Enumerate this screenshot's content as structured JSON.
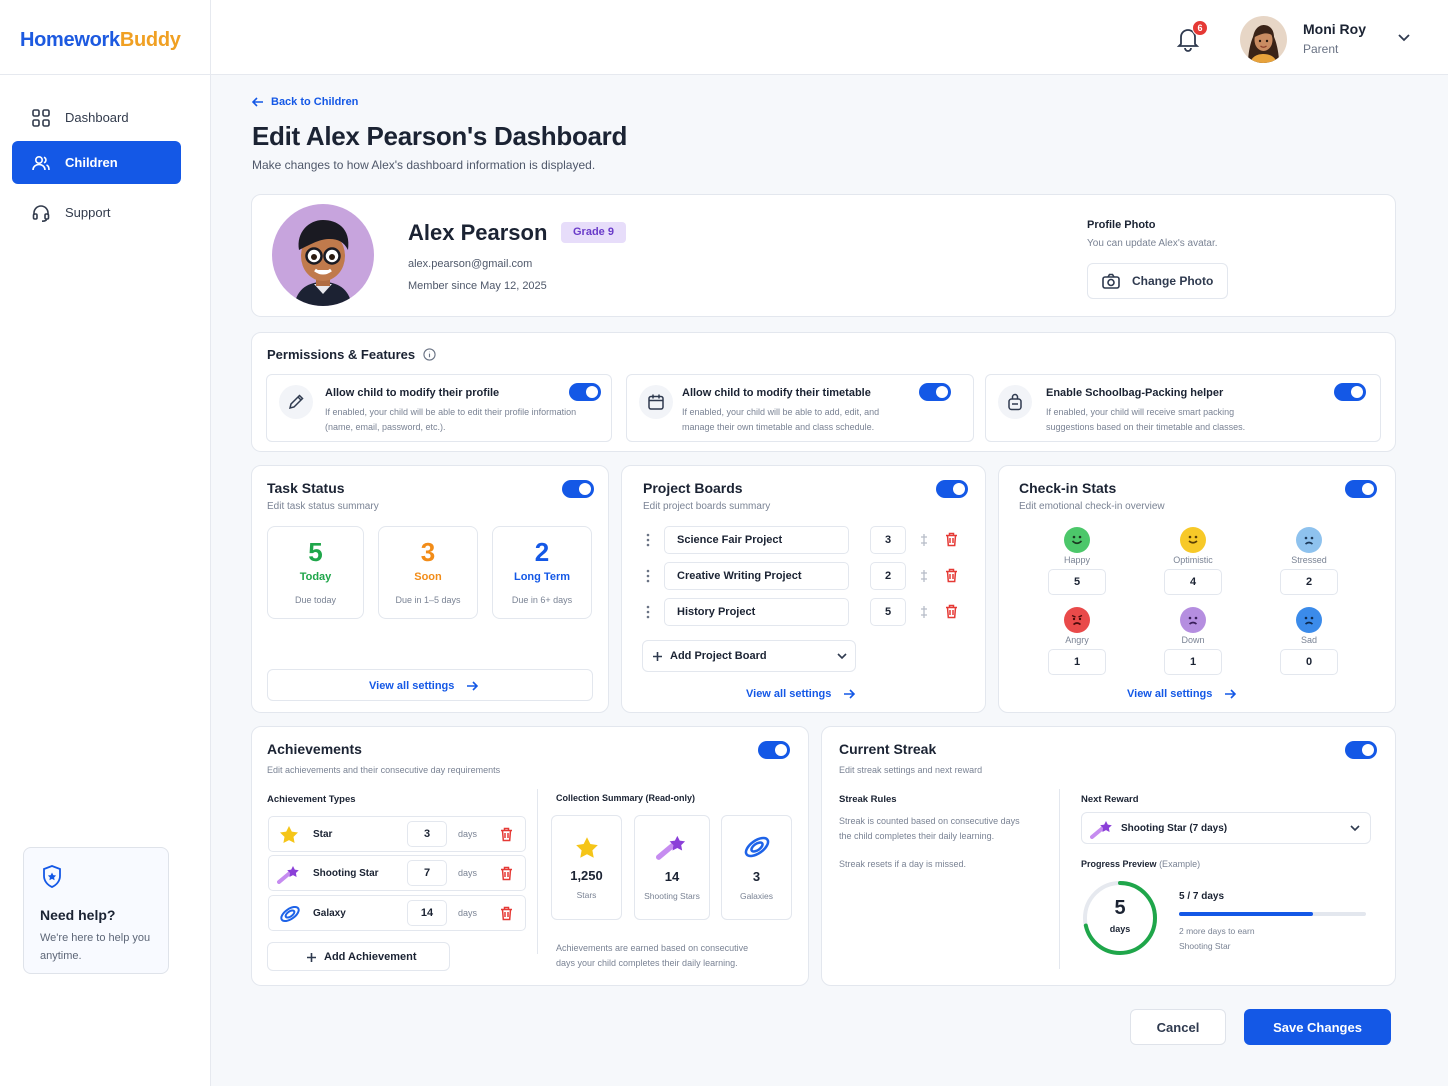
{
  "brand": {
    "part1": "Homework",
    "part2": "Buddy"
  },
  "sidebar": {
    "items": [
      {
        "label": "Dashboard",
        "icon": "grid-icon"
      },
      {
        "label": "Children",
        "icon": "users-icon",
        "active": true
      },
      {
        "label": "Support",
        "icon": "headset-icon"
      }
    ],
    "help": {
      "title": "Need help?",
      "text": "We're here to help you anytime."
    }
  },
  "topbar": {
    "notifications": "6",
    "user_name": "Moni Roy",
    "user_role": "Parent"
  },
  "page": {
    "back": "Back to Children",
    "title": "Edit Alex Pearson's Dashboard",
    "subtitle": "Make changes to how Alex's dashboard information is displayed."
  },
  "profile": {
    "name": "Alex Pearson",
    "grade": "Grade 9",
    "email": "alex.pearson@gmail.com",
    "member_since": "Member since May 12, 2025",
    "photo_title": "Profile Photo",
    "photo_sub": "You can update Alex's avatar.",
    "change_photo": "Change Photo"
  },
  "permissions": {
    "title": "Permissions & Features",
    "items": [
      {
        "title": "Allow child to modify their profile",
        "desc1": "If enabled, your child will be able to edit their profile information",
        "desc2": "(name, email, password, etc.).",
        "enabled": true
      },
      {
        "title": "Allow child to modify their timetable",
        "desc1": "If enabled, your child will be able to add, edit, and",
        "desc2": "manage their own timetable and class schedule.",
        "enabled": true
      },
      {
        "title": "Enable Schoolbag-Packing helper",
        "desc1": "If enabled, your child will receive smart packing",
        "desc2": "suggestions based on their timetable and classes.",
        "enabled": true
      }
    ]
  },
  "task_status": {
    "title": "Task Status",
    "subtitle": "Edit task status summary",
    "enabled": true,
    "stats": [
      {
        "value": "5",
        "label": "Today",
        "desc": "Due today",
        "color": "#1fa64a"
      },
      {
        "value": "3",
        "label": "Soon",
        "desc": "Due in 1–5 days",
        "color": "#f28c18"
      },
      {
        "value": "2",
        "label": "Long Term",
        "desc": "Due in 6+ days",
        "color": "#1458e6"
      }
    ],
    "link": "View all settings"
  },
  "project_boards": {
    "title": "Project Boards",
    "subtitle": "Edit project boards summary",
    "enabled": true,
    "items": [
      {
        "name": "Science Fair Project",
        "count": "3"
      },
      {
        "name": "Creative Writing Project",
        "count": "2"
      },
      {
        "name": "History Project",
        "count": "5"
      }
    ],
    "add": "Add Project Board",
    "link": "View all settings"
  },
  "checkin": {
    "title": "Check-in Stats",
    "subtitle": "Edit emotional check-in overview",
    "enabled": true,
    "moods": [
      {
        "label": "Happy",
        "value": "5",
        "color": "#4cc76a"
      },
      {
        "label": "Optimistic",
        "value": "4",
        "color": "#f7c928"
      },
      {
        "label": "Stressed",
        "value": "2",
        "color": "#8ec2ee"
      },
      {
        "label": "Angry",
        "value": "1",
        "color": "#e94a4a"
      },
      {
        "label": "Down",
        "value": "1",
        "color": "#b58ee0"
      },
      {
        "label": "Sad",
        "value": "0",
        "color": "#3b8bea"
      }
    ],
    "link": "View all settings"
  },
  "achievements": {
    "title": "Achievements",
    "subtitle": "Edit achievements and their consecutive day requirements",
    "enabled": true,
    "types_title": "Achievement Types",
    "types": [
      {
        "name": "Star",
        "days": "3",
        "unit": "days"
      },
      {
        "name": "Shooting Star",
        "days": "7",
        "unit": "days"
      },
      {
        "name": "Galaxy",
        "days": "14",
        "unit": "days"
      }
    ],
    "add": "Add Achievement",
    "summary_title": "Collection Summary (Read-only)",
    "summary": [
      {
        "value": "1,250",
        "label": "Stars"
      },
      {
        "value": "14",
        "label": "Shooting Stars"
      },
      {
        "value": "3",
        "label": "Galaxies"
      }
    ],
    "note1": "Achievements are earned based on consecutive",
    "note2": "days your child completes their daily learning."
  },
  "streak": {
    "title": "Current Streak",
    "subtitle": "Edit streak settings and next reward",
    "enabled": true,
    "rules_title": "Streak Rules",
    "rule1a": "Streak is counted based on consecutive days",
    "rule1b": "the child completes their daily learning.",
    "rule2": "Streak resets if a day is missed.",
    "reward_title": "Next Reward",
    "reward": "Shooting Star (7 days)",
    "preview_title": "Progress Preview",
    "preview_tag": "(Example)",
    "current": "5",
    "unit": "days",
    "progress_text": "5 / 7 days",
    "progress": 0.714,
    "remaining1": "2 more days to earn",
    "remaining2": "Shooting Star"
  },
  "actions": {
    "cancel": "Cancel",
    "save": "Save Changes"
  },
  "colors": {
    "primary": "#1458e6",
    "brand_orange": "#f0a023",
    "delete": "#e53935"
  }
}
